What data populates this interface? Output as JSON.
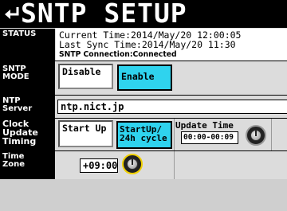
{
  "header": {
    "title": "SNTP SETUP",
    "back_icon": "back-arrow-icon"
  },
  "status": {
    "label": "STATUS",
    "current_time": "Current  Time:2014/May/20  12:00:05",
    "last_sync": "Last Sync Time:2014/May/20  11:30",
    "connection": "SNTP Connection:Connected"
  },
  "sntp_mode": {
    "label_line1": "SNTP",
    "label_line2": "MODE",
    "disable_label": "Disable",
    "enable_label": "Enable",
    "selected": "Enable"
  },
  "ntp_server": {
    "label_line1": "NTP",
    "label_line2": "Server",
    "value": "ntp.nict.jp"
  },
  "clock_update": {
    "label_line1": "Clock",
    "label_line2": "Update",
    "label_line3": "Timing",
    "startup_label": "Start Up",
    "startup24_line1": "StartUp/",
    "startup24_line2": "24h cycle",
    "selected": "StartUp/24h cycle",
    "update_time_label": "Update Time",
    "update_time_value": "00:00-00:09"
  },
  "time_zone": {
    "label_line1": "Time",
    "label_line2": "Zone",
    "value": "+09:00"
  },
  "colors": {
    "active_button": "#2fd3ee",
    "label_background": "#000000",
    "knob_highlight": "#f0d000"
  }
}
